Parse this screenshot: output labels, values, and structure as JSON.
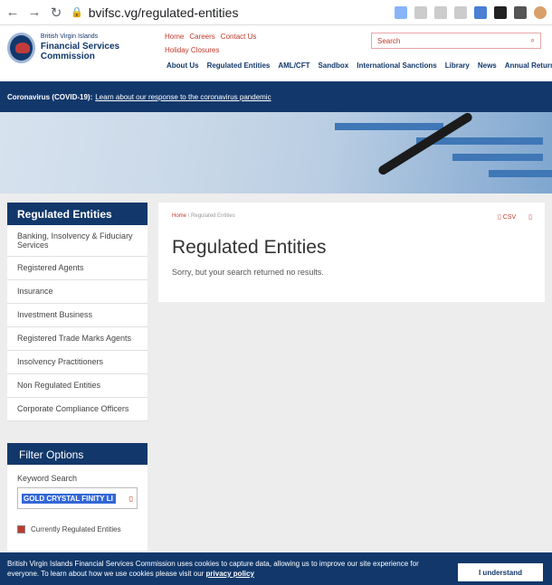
{
  "browser": {
    "url": "bvifsc.vg/regulated-entities"
  },
  "header": {
    "logo_line1": "British Virgin Islands",
    "logo_line2": "Financial Services Commission",
    "top_links": [
      "Home",
      "Careers",
      "Contact Us",
      "Holiday Closures"
    ],
    "nav": [
      "About Us",
      "Regulated Entities",
      "AML/CFT",
      "Sandbox",
      "International Sanctions",
      "Library",
      "News",
      "Annual Returns"
    ],
    "search_placeholder": "Search"
  },
  "covid": {
    "label": "Coronavirus (COVID-19):",
    "link": "Learn about our response to the coronavirus pandemic"
  },
  "sidebar": {
    "title": "Regulated Entities",
    "items": [
      "Banking, Insolvency & Fiduciary Services",
      "Registered Agents",
      "Insurance",
      "Investment Business",
      "Registered Trade Marks Agents",
      "Insolvency Practitioners",
      "Non Regulated Entities",
      "Corporate Compliance Officers"
    ]
  },
  "filter": {
    "title": "Filter Options",
    "keyword_label": "Keyword Search",
    "keyword_value": "GOLD CRYSTAL FINITY LI",
    "status_label": "Currently Regulated Entities"
  },
  "main": {
    "breadcrumb_home": "Home",
    "breadcrumb_current": "Regulated Entities",
    "csv_label": "CSV",
    "title": "Regulated Entities",
    "message": "Sorry, but your search returned no results."
  },
  "cookie": {
    "text": "British Virgin Islands Financial Services Commission uses cookies to capture data, allowing us to improve our site experience for everyone. To learn about how we use cookies please visit our",
    "link": "privacy policy",
    "button": "I understand"
  },
  "colors": {
    "navy": "#12386b",
    "accent_red": "#c0392b"
  }
}
